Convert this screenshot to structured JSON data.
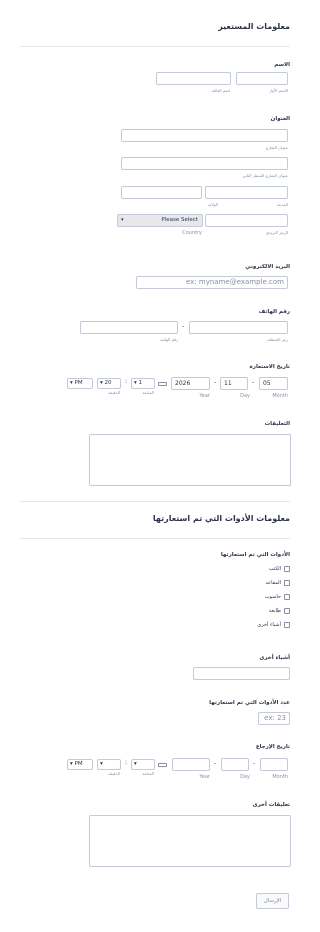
{
  "section1": {
    "title": "معلومات المستعير"
  },
  "name": {
    "label": "الاسم",
    "first_sub": "الاسم الأول",
    "last_sub": "اسم العائلة"
  },
  "address": {
    "label": "العنوان",
    "street_sub": "عنوان الشارع",
    "street2_sub": "عنوان الشارع السطر الثاني",
    "city_sub": "المدينة",
    "state_sub": "الولاية",
    "zip_sub": "الرمز البريدي",
    "country_value": "Please Select",
    "country_sub": "Country"
  },
  "email": {
    "label": "البريد الالكتروني",
    "placeholder": "ex: myname@example.com"
  },
  "phone": {
    "label": "رقم الهاتف",
    "area_sub": "رمز المنطقة",
    "number_sub": "رقم الهاتف",
    "dash": "-"
  },
  "borrow_date": {
    "label": "تاريخ الاستعارة",
    "month": "05",
    "day": "11",
    "year": "2026",
    "month_sub": "Month",
    "day_sub": "Day",
    "year_sub": "Year",
    "hour": "1",
    "minute": "20",
    "ampm": "PM",
    "hour_sub": "الساعة",
    "minute_sub": "الدقيقة",
    "dash": "-",
    "colon": ":"
  },
  "comments": {
    "label": "التعليقات"
  },
  "section2": {
    "title": "معلومات الأدوات التي تم استعارتها"
  },
  "tools": {
    "label": "الأدوات التي تم استعارتها",
    "options": [
      "الكتب",
      "المقاعد",
      "حاسوب",
      "طابعة",
      "أشياء أخرى"
    ]
  },
  "other_items": {
    "label": "أشياء أخرى"
  },
  "count": {
    "label": "عدد الأدوات التي تم استعارتها",
    "placeholder": "ex: 23"
  },
  "return_date": {
    "label": "تاريخ الإرجاع",
    "month_sub": "Month",
    "day_sub": "Day",
    "year_sub": "Year",
    "hour_sub": "الساعة",
    "minute_sub": "الدقيقة",
    "ampm": "PM",
    "dash": "-",
    "colon": ":"
  },
  "other_comments": {
    "label": "تعليقات أخرى"
  },
  "submit": {
    "label": "الإرسال"
  }
}
